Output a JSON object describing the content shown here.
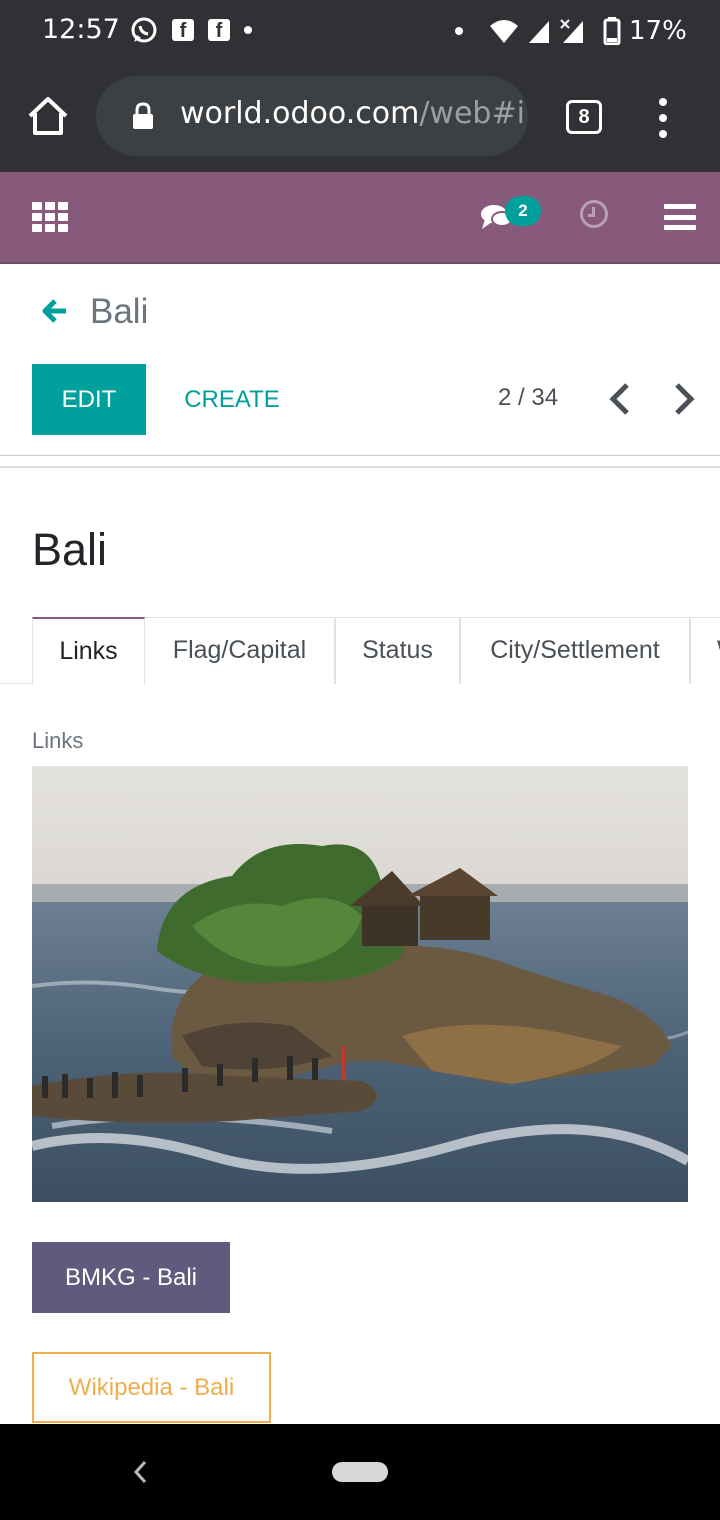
{
  "status_bar": {
    "time": "12:57",
    "battery": "17%",
    "icons": [
      "whatsapp-icon",
      "facebook-icon",
      "facebook-icon",
      "dot-icon",
      "dot-icon",
      "wifi-icon",
      "signal-icon",
      "signal-x-icon",
      "battery-icon"
    ]
  },
  "browser": {
    "url_host": "world.odoo.com",
    "url_path": "/web#i",
    "tab_count": "8"
  },
  "navbar": {
    "bg_color": "#875a7b",
    "messages_badge": "2"
  },
  "control_panel": {
    "breadcrumb": "Bali",
    "edit_label": "EDIT",
    "create_label": "CREATE",
    "pager": "2 / 34"
  },
  "form": {
    "title": "Bali",
    "tabs": [
      {
        "label": "Links",
        "active": true
      },
      {
        "label": "Flag/Capital",
        "active": false
      },
      {
        "label": "Status",
        "active": false
      },
      {
        "label": "City/Settlement",
        "active": false
      },
      {
        "label": "W",
        "active": false
      }
    ],
    "section_label": "Links",
    "buttons": {
      "bmkg": "BMKG - Bali",
      "wikipedia": "Wikipedia - Bali"
    }
  },
  "colors": {
    "accent": "#00a09d",
    "brand": "#875a7b",
    "bmkg": "#5f5b7d",
    "wiki": "#f0ad4e"
  }
}
